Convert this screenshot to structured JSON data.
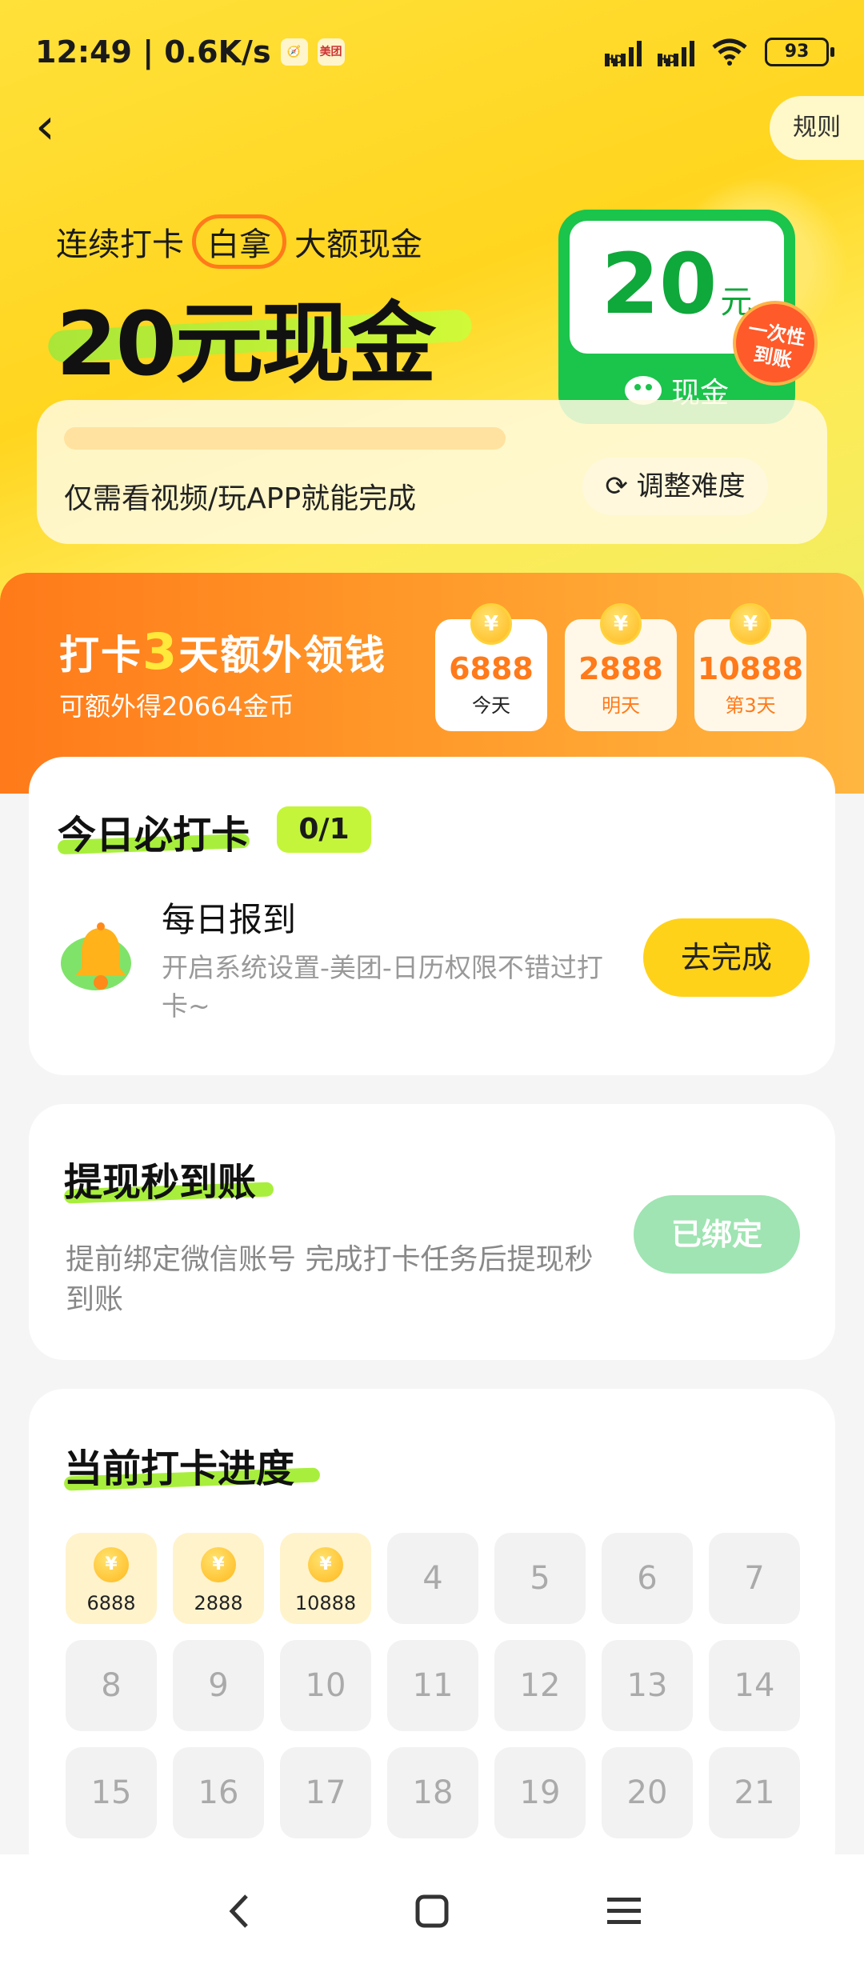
{
  "status_bar": {
    "time_speed": "12:49 | 0.6K/s",
    "app_icon_1": "🧭",
    "app_icon_2": "美团",
    "battery": "93"
  },
  "header": {
    "back_icon": "‹",
    "rules_label": "规则"
  },
  "hero": {
    "sub_prefix": "连续打卡",
    "sub_circled": "白拿",
    "sub_suffix": "大额现金",
    "main": "20元现金",
    "cash_amount": "20",
    "cash_unit": "元",
    "cash_label": "现金",
    "once_badge_line1": "一次性",
    "once_badge_line2": "到账",
    "task_hint": "仅需看视频/玩APP就能完成",
    "adjust_label": "调整难度",
    "progress_fraction": 0
  },
  "bonus": {
    "title_prefix": "打卡",
    "title_num": "3",
    "title_suffix": "天额外领钱",
    "subtitle": "可额外得20664金币",
    "coin_symbol": "¥",
    "days": [
      {
        "value": "6888",
        "label": "今天"
      },
      {
        "value": "2888",
        "label": "明天"
      },
      {
        "value": "10888",
        "label": "第3天"
      }
    ]
  },
  "daily": {
    "title": "今日必打卡",
    "count": "0/1",
    "item_title": "每日报到",
    "item_desc": "开启系统设置-美团-日历权限不错过打卡~",
    "item_button": "去完成"
  },
  "withdraw": {
    "title": "提现秒到账",
    "desc": "提前绑定微信账号 完成打卡任务后提现秒到账",
    "button": "已绑定"
  },
  "progress": {
    "title": "当前打卡进度",
    "coin_symbol": "¥",
    "done_cells": [
      {
        "value": "6888"
      },
      {
        "value": "2888"
      },
      {
        "value": "10888"
      }
    ],
    "days": [
      "4",
      "5",
      "6",
      "7",
      "8",
      "9",
      "10",
      "11",
      "12",
      "13",
      "14",
      "15",
      "16",
      "17",
      "18",
      "19",
      "20",
      "21"
    ]
  },
  "nav": {
    "back": "back-icon",
    "home": "home-icon",
    "menu": "menu-icon"
  },
  "colors": {
    "brand_yellow": "#ffd21a",
    "cash_green": "#1bc44b",
    "bonus_orange": "#ff7a1a",
    "highlight_green": "#c4f53a"
  }
}
